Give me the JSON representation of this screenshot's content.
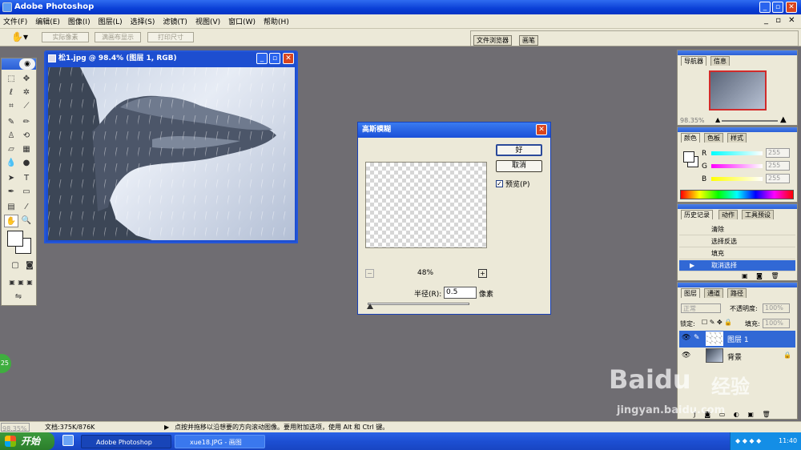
{
  "app": {
    "title": "Adobe Photoshop"
  },
  "menu": [
    "文件(F)",
    "编辑(E)",
    "图像(I)",
    "图层(L)",
    "选择(S)",
    "滤镜(T)",
    "视图(V)",
    "窗口(W)",
    "帮助(H)"
  ],
  "options_bar": {
    "btn1": "实际像素",
    "btn2": "满画布显示",
    "btn3": "打印尺寸",
    "well_tab1": "文件浏览器",
    "well_tab2": "画笔"
  },
  "document": {
    "title": "松1.jpg @ 98.4% (图层 1, RGB)"
  },
  "dialog": {
    "title": "高斯模糊",
    "ok": "好",
    "cancel": "取消",
    "preview_checked": true,
    "preview_label": "预览(P)",
    "zoom": "48%",
    "minus": "−",
    "plus": "+",
    "radius_label": "半径(R):",
    "radius_value": "0.5",
    "unit": "像素",
    "slider_level": 0.02
  },
  "navigator": {
    "tab1": "导航器",
    "tab2": "信息",
    "zoom": "98.35%"
  },
  "color": {
    "tab1": "颜色",
    "tab2": "色板",
    "tab3": "样式",
    "r_label": "R",
    "g_label": "G",
    "b_label": "B",
    "r": "255",
    "g": "255",
    "b": "255"
  },
  "history": {
    "tab1": "历史记录",
    "tab2": "动作",
    "tab3": "工具预设",
    "items": [
      "清除",
      "选择反选",
      "填充",
      "取消选择"
    ]
  },
  "layers": {
    "tab1": "图层",
    "tab2": "通道",
    "tab3": "路径",
    "blend_mode": "正常",
    "opacity_label": "不透明度:",
    "opacity": "100%",
    "lock_label": "锁定:",
    "fill_label": "填充:",
    "fill": "100%",
    "layer1": "图层 1",
    "layer2": "背景"
  },
  "status": {
    "zoom": "98.35%",
    "doc": "文档:375K/876K",
    "hint": "点按并拖移以沿想要的方向滚动图像。要用附加选项，使用 Alt 和 Ctrl 键。"
  },
  "taskbar": {
    "start": "开始",
    "task1": "Adobe Photoshop",
    "task2": "xue18.JPG - 画图",
    "clock": "11:40"
  },
  "side_badge": "25",
  "watermark": {
    "line1": "Baidu",
    "line2": "经验",
    "line3": "jingyan.baidu.com"
  },
  "colors": {
    "title_blue": "#0a3fd6",
    "panel_bg": "#ece9d8",
    "canvas_bg": "#6f6d72",
    "selected_row": "#3168d5"
  }
}
